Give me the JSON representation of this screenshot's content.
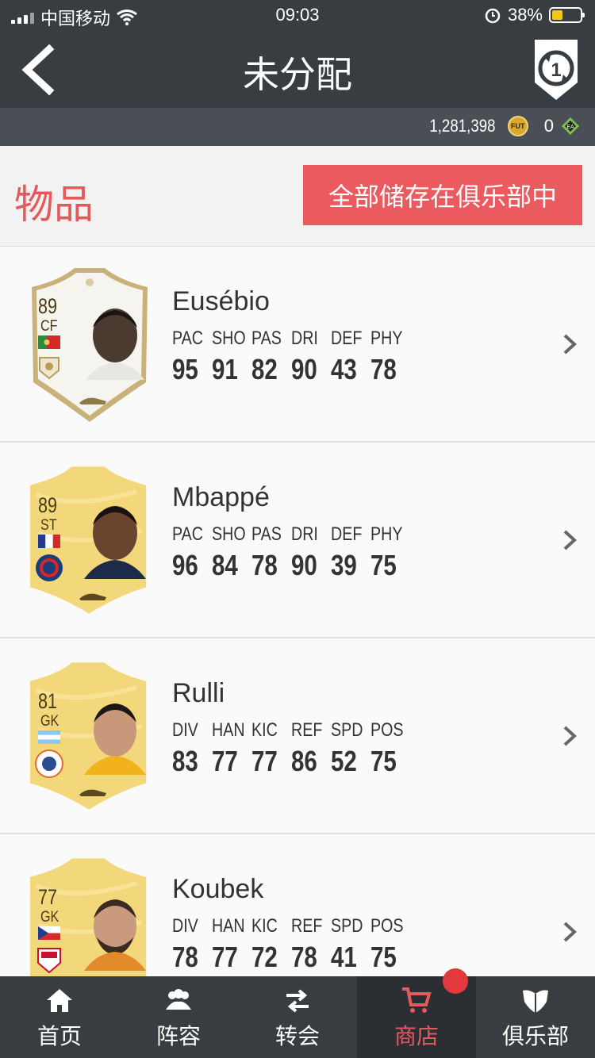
{
  "status_bar": {
    "carrier": "中国移动",
    "time": "09:03",
    "battery": "38%",
    "battery_level": 0.38
  },
  "nav": {
    "title": "未分配"
  },
  "currency": {
    "coins": "1,281,398",
    "coin_label": "FUT",
    "points": "0"
  },
  "header": {
    "items_title": "物品",
    "store_all_label": "全部储存在俱乐部中"
  },
  "players": [
    {
      "name": "Eusébio",
      "rating": "89",
      "position": "CF",
      "card": "icon",
      "stat_labels": [
        "PAC",
        "SHO",
        "PAS",
        "DRI",
        "DEF",
        "PHY"
      ],
      "stat_values": [
        "95",
        "91",
        "82",
        "90",
        "43",
        "78"
      ]
    },
    {
      "name": "Mbappé",
      "rating": "89",
      "position": "ST",
      "card": "gold",
      "stat_labels": [
        "PAC",
        "SHO",
        "PAS",
        "DRI",
        "DEF",
        "PHY"
      ],
      "stat_values": [
        "96",
        "84",
        "78",
        "90",
        "39",
        "75"
      ]
    },
    {
      "name": "Rulli",
      "rating": "81",
      "position": "GK",
      "card": "gold",
      "stat_labels": [
        "DIV",
        "HAN",
        "KIC",
        "REF",
        "SPD",
        "POS"
      ],
      "stat_values": [
        "83",
        "77",
        "77",
        "86",
        "52",
        "75"
      ]
    },
    {
      "name": "Koubek",
      "rating": "77",
      "position": "GK",
      "card": "gold",
      "stat_labels": [
        "DIV",
        "HAN",
        "KIC",
        "REF",
        "SPD",
        "POS"
      ],
      "stat_values": [
        "78",
        "77",
        "72",
        "78",
        "41",
        "75"
      ]
    }
  ],
  "tabs": [
    {
      "label": "首页",
      "icon": "home-icon"
    },
    {
      "label": "阵容",
      "icon": "squad-icon"
    },
    {
      "label": "转会",
      "icon": "transfer-icon"
    },
    {
      "label": "商店",
      "icon": "cart-icon",
      "active": true
    },
    {
      "label": "俱乐部",
      "icon": "club-icon"
    }
  ],
  "colors": {
    "accent": "#ea5a5e",
    "bar": "#383d42",
    "gold": "#f2d87a"
  }
}
